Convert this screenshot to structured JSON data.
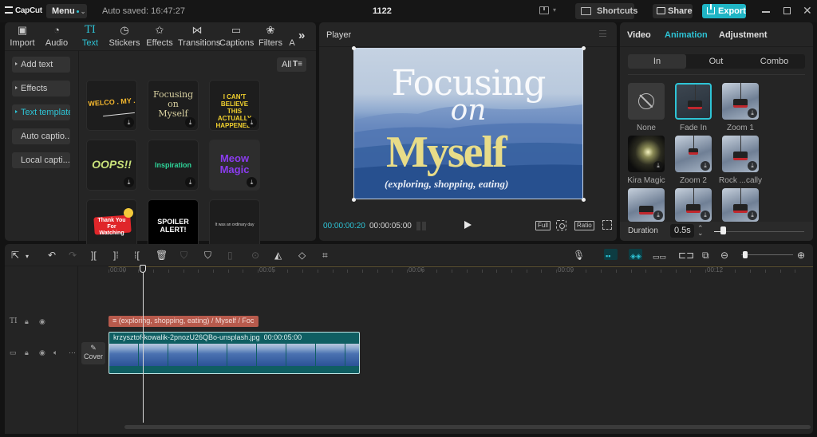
{
  "titlebar": {
    "app_name": "CapCut",
    "menu_label": "Menu",
    "autosave_text": "Auto saved: 16:47:27",
    "project_title": "1122",
    "shortcuts_label": "Shortcuts",
    "share_label": "Share",
    "export_label": "Export",
    "accent_color": "#1fb5c5"
  },
  "media_tabs": [
    {
      "label": "Import",
      "icon": "import-icon"
    },
    {
      "label": "Audio",
      "icon": "audio-icon"
    },
    {
      "label": "Text",
      "icon": "text-icon",
      "active": true
    },
    {
      "label": "Stickers",
      "icon": "sticker-icon"
    },
    {
      "label": "Effects",
      "icon": "effects-icon"
    },
    {
      "label": "Transitions",
      "icon": "transitions-icon"
    },
    {
      "label": "Captions",
      "icon": "captions-icon"
    },
    {
      "label": "Filters",
      "icon": "filters-icon"
    },
    {
      "label": "A",
      "icon": ""
    }
  ],
  "text_sidebar": [
    {
      "label": "Add text"
    },
    {
      "label": "Effects"
    },
    {
      "label": "Text template",
      "active": true
    },
    {
      "label": "Auto captio..."
    },
    {
      "label": "Local capti..."
    }
  ],
  "filter": {
    "label": "All"
  },
  "templates": [
    {
      "text": "WELCO . MY .",
      "color": "#f5b82e"
    },
    {
      "text": "Focusing on Myself",
      "color": "#d8d0a0"
    },
    {
      "text": "I CAN'T BELIEVE THIS ACTUALLY HAPPENED!",
      "color": "#f3d22e"
    },
    {
      "text": "OOPS!!",
      "color": "#c9e27a"
    },
    {
      "text": "Inspiration",
      "color": "#2fd69a"
    },
    {
      "text": "Meow Magic",
      "color": "#8b3cf0"
    },
    {
      "text": "Thank You For Watching",
      "color": "#e0262a"
    },
    {
      "text": "SPOILER ALERT!",
      "color": "#ffffff"
    },
    {
      "text": "It was an ordinary day",
      "color": "#d8c84a"
    }
  ],
  "player": {
    "title": "Player",
    "canvas": {
      "line1": "Focusing",
      "line2": "on",
      "line3": "Myself",
      "line4": "(exploring, shopping, eating)"
    },
    "current_time": "00:00:00:20",
    "total_time": "00:00:05:00",
    "full_label": "Full",
    "ratio_label": "Ratio"
  },
  "inspector": {
    "tabs": [
      {
        "label": "Video"
      },
      {
        "label": "Animation",
        "active": true
      },
      {
        "label": "Adjustment"
      }
    ],
    "segments": [
      {
        "label": "In",
        "active": true
      },
      {
        "label": "Out"
      },
      {
        "label": "Combo"
      }
    ],
    "animations": [
      {
        "label": "None"
      },
      {
        "label": "Fade In",
        "selected": true
      },
      {
        "label": "Zoom 1"
      },
      {
        "label": "Kira Magic"
      },
      {
        "label": "Zoom 2"
      },
      {
        "label": "Rock ...cally"
      },
      {
        "label": ""
      },
      {
        "label": ""
      },
      {
        "label": ""
      }
    ],
    "duration_label": "Duration",
    "duration_value": "0.5s",
    "duration_slider_fraction": 0.1
  },
  "timeline": {
    "ruler_labels": [
      "00:00",
      "00:05",
      "00:06",
      "00:09",
      "00:12"
    ],
    "text_clip_label": "(exploring, shopping, eating) / Myself / Foc",
    "cover_label": "Cover",
    "video_clip_name": "krzysztof-kowalik-2pnozU26QBo-unsplash.jpg",
    "video_clip_duration": "00:00:05:00",
    "zoom_fraction": 0.08
  }
}
